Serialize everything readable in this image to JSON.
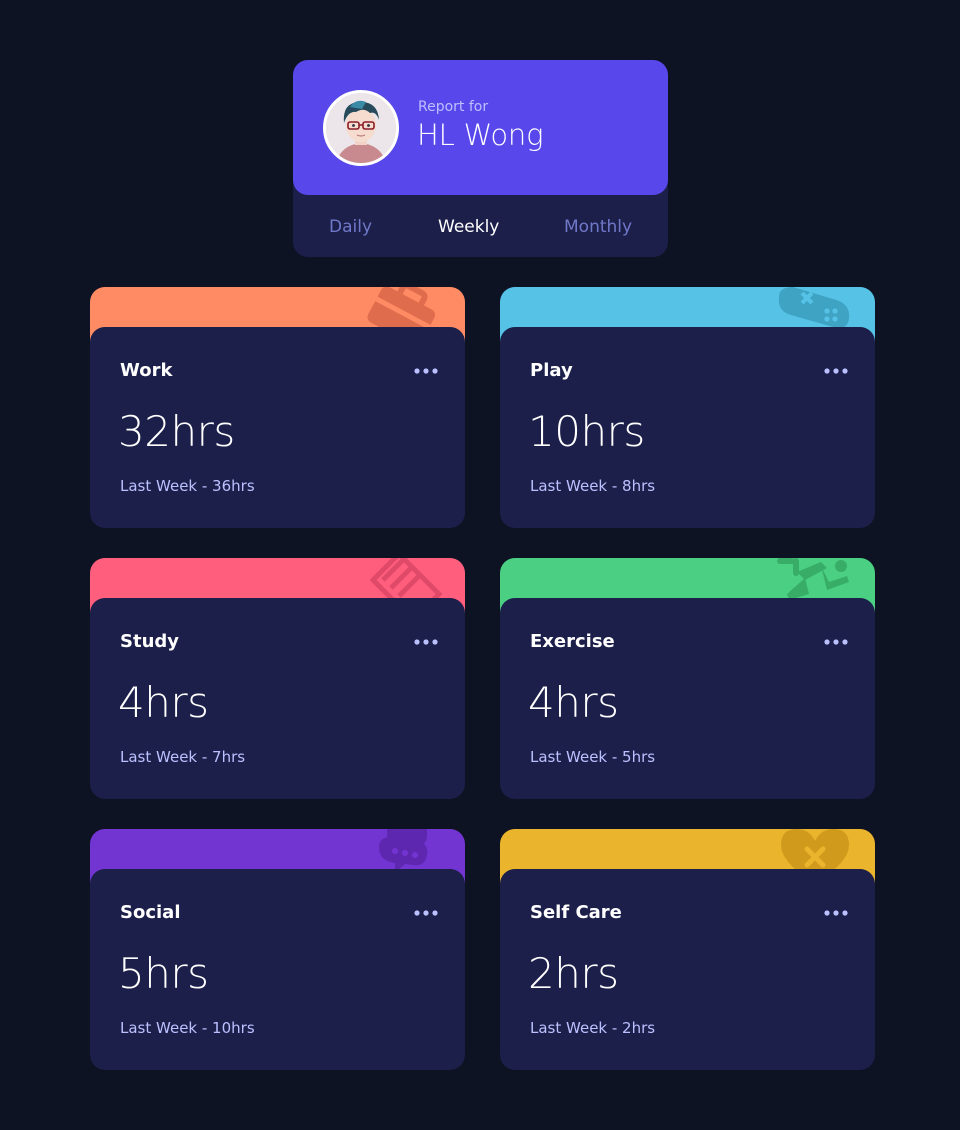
{
  "profile": {
    "report_for": "Report for",
    "name": "HL Wong"
  },
  "tabs": [
    {
      "label": "Daily",
      "active": false
    },
    {
      "label": "Weekly",
      "active": true
    },
    {
      "label": "Monthly",
      "active": false
    }
  ],
  "cards": [
    {
      "title": "Work",
      "current": "32hrs",
      "previous": "Last Week - 36hrs",
      "color": "#ff8b64",
      "icon": "briefcase-icon"
    },
    {
      "title": "Play",
      "current": "10hrs",
      "previous": "Last Week - 8hrs",
      "color": "#55c2e6",
      "icon": "gamepad-icon"
    },
    {
      "title": "Study",
      "current": "4hrs",
      "previous": "Last Week - 7hrs",
      "color": "#ff5e7d",
      "icon": "book-icon"
    },
    {
      "title": "Exercise",
      "current": "4hrs",
      "previous": "Last Week - 5hrs",
      "color": "#4bcf82",
      "icon": "running-icon"
    },
    {
      "title": "Social",
      "current": "5hrs",
      "previous": "Last Week - 10hrs",
      "color": "#7335d2",
      "icon": "chat-icon"
    },
    {
      "title": "Self Care",
      "current": "2hrs",
      "previous": "Last Week - 2hrs",
      "color": "#f1c75b",
      "icon": "heart-icon"
    }
  ],
  "colors": {
    "background": "#0e1323",
    "card": "#1c1f4a",
    "profile": "#5847eb",
    "muted": "#bbc0ff",
    "tab_inactive": "#7078c9"
  }
}
